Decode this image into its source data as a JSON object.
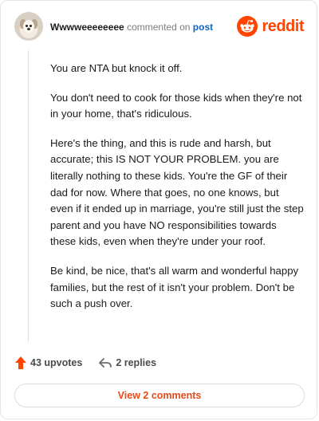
{
  "comment": {
    "username": "Wwwweeeeeeee",
    "action_text": "commented on",
    "target_text": "post",
    "paragraphs": [
      "You are NTA but knock it off.",
      "You don't need to cook for those kids when they're not in your home, that's ridiculous.",
      "Here's the thing, and this is rude and harsh, but accurate; this IS NOT YOUR PROBLEM. you are literally nothing to these kids. You're the GF of their dad for now. Where that goes, no one knows, but even if it ended up in marriage, you're still just the step parent and you have NO responsibilities towards these kids, even when they're under your roof.",
      "Be kind, be nice, that's all warm and wonderful happy families, but the rest of it isn't your problem. Don't be such a push over."
    ]
  },
  "brand": {
    "wordmark": "reddit",
    "icon": "reddit-snoo-icon",
    "color": "#ff4500"
  },
  "actions": {
    "upvotes_label": "43 upvotes",
    "replies_label": "2 replies",
    "upvote_icon": "upvote-arrow-icon",
    "reply_icon": "reply-arrow-icon",
    "upvote_color": "#ff4500"
  },
  "footer": {
    "view_comments_label": "View 2 comments"
  }
}
